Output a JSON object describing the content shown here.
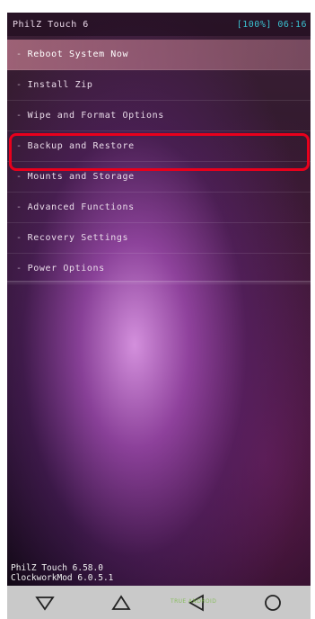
{
  "status_bar": {
    "title": "PhilZ Touch 6",
    "battery_time": "[100%] 06:16"
  },
  "menu": {
    "items": [
      {
        "label": "Reboot System Now",
        "selected": true
      },
      {
        "label": "Install Zip",
        "selected": false
      },
      {
        "label": "Wipe and Format Options",
        "selected": false
      },
      {
        "label": "Backup and Restore",
        "selected": false
      },
      {
        "label": "Mounts and Storage",
        "selected": false
      },
      {
        "label": "Advanced Functions",
        "selected": false
      },
      {
        "label": "Recovery Settings",
        "selected": false
      },
      {
        "label": "Power Options",
        "selected": false
      }
    ],
    "item_prefix": "-"
  },
  "highlight": {
    "target_label": "Backup and Restore",
    "color": "#e8001c"
  },
  "footer": {
    "version_line1": "PhilZ Touch 6.58.0",
    "version_line2": "ClockworkMod 6.0.5.1"
  },
  "nav_bar": {
    "buttons": [
      "back-triangle-icon",
      "home-triangle-icon",
      "back-icon",
      "circle-icon"
    ]
  },
  "watermark": {
    "text": "TRUE ANDROID"
  },
  "colors": {
    "status_accent": "#3ac0d0",
    "selected_row": "#be788c",
    "highlight_border": "#e8001c"
  }
}
